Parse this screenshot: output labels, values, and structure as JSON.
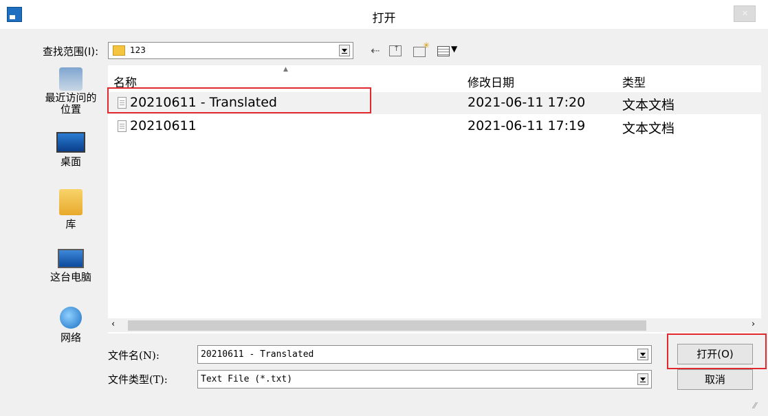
{
  "window": {
    "title": "打开"
  },
  "look_in": {
    "label": "查找范围(I):",
    "value": "123"
  },
  "toolbar": {
    "back_icon": "back-arrow-icon",
    "up_icon": "up-folder-icon",
    "new_folder_icon": "new-folder-icon",
    "view_menu_icon": "view-menu-icon"
  },
  "places": [
    {
      "label": "最近访问的位置",
      "icon": "recent-places-icon"
    },
    {
      "label": "桌面",
      "icon": "desktop-icon"
    },
    {
      "label": "库",
      "icon": "libraries-icon"
    },
    {
      "label": "这台电脑",
      "icon": "computer-icon"
    },
    {
      "label": "网络",
      "icon": "network-icon"
    }
  ],
  "columns": {
    "name": "名称",
    "modified": "修改日期",
    "type": "类型"
  },
  "files": [
    {
      "name": "20210611 - Translated",
      "modified": "2021-06-11 17:20",
      "type": "文本文档"
    },
    {
      "name": "20210611",
      "modified": "2021-06-11 17:19",
      "type": "文本文档"
    }
  ],
  "filename": {
    "label": "文件名(N):",
    "value": "20210611 - Translated"
  },
  "filetype": {
    "label": "文件类型(T):",
    "value": "Text File (*.txt)"
  },
  "buttons": {
    "open": "打开(O)",
    "cancel": "取消"
  },
  "scroll": {
    "left": "‹",
    "right": "›"
  },
  "colors": {
    "highlight": "#e0282e",
    "accent": "#1e6fc0"
  }
}
